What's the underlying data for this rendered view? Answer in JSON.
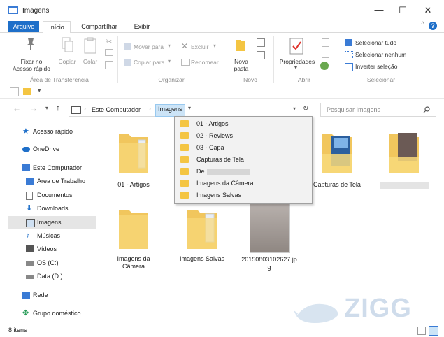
{
  "window": {
    "title": "Imagens"
  },
  "tabs": [
    "Arquivo",
    "Início",
    "Compartilhar",
    "Exibir"
  ],
  "ribbon": {
    "groups": [
      "Área de Transferência",
      "Organizar",
      "Novo",
      "Abrir",
      "Selecionar"
    ],
    "pin_label_1": "Fixar no",
    "pin_label_2": "Acesso rápido",
    "copy_label": "Copiar",
    "paste_label": "Colar",
    "move_to": "Mover para",
    "copy_to": "Copiar para",
    "delete": "Excluir",
    "rename": "Renomear",
    "new_folder_1": "Nova",
    "new_folder_2": "pasta",
    "properties": "Propriedades",
    "select_all": "Selecionar tudo",
    "select_none": "Selecionar nenhum",
    "invert_selection": "Inverter seleção"
  },
  "address": {
    "root": "Este Computador",
    "current": "Imagens",
    "search_placeholder": "Pesquisar Imagens"
  },
  "nav": {
    "items": [
      {
        "label": "Acesso rápido"
      },
      {
        "label": "OneDrive"
      },
      {
        "label": "Este Computador"
      },
      {
        "label": "Área de Trabalho"
      },
      {
        "label": "Documentos"
      },
      {
        "label": "Downloads"
      },
      {
        "label": "Imagens"
      },
      {
        "label": "Músicas"
      },
      {
        "label": "Vídeos"
      },
      {
        "label": "OS (C:)"
      },
      {
        "label": "Data (D:)"
      },
      {
        "label": "Rede"
      },
      {
        "label": "Grupo doméstico"
      }
    ]
  },
  "files": [
    {
      "name": "01 - Artigos"
    },
    {
      "name": "Capturas de Tela"
    },
    {
      "name": "Imagens da Câmera"
    },
    {
      "name": "Imagens Salvas"
    },
    {
      "name": "20150803102627.jpg"
    }
  ],
  "dropdown": {
    "items": [
      "01 - Artigos",
      "02 - Reviews",
      "03 - Capa",
      "Capturas de Tela",
      "De",
      "Imagens da Câmera",
      "Imagens Salvas"
    ]
  },
  "status": {
    "count": "8 itens"
  },
  "watermark": "ZIGG",
  "colors": {
    "accent": "#1e6fc9",
    "folder": "#f4c542",
    "selected_bg": "#e5e5e5"
  }
}
